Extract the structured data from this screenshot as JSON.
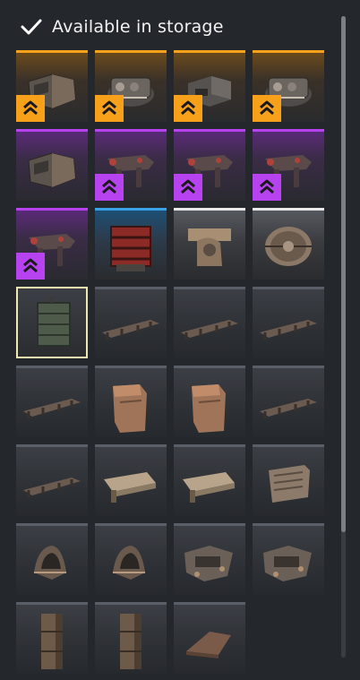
{
  "header": {
    "title": "Available in storage",
    "icon": "check-icon"
  },
  "colors": {
    "orange": "#f7a11a",
    "purple": "#b743f0",
    "blue": "#39a3e6",
    "white": "#e8e8e8",
    "selected_border": "#efe8b0",
    "background": "#24272c"
  },
  "items": [
    {
      "name": "item-cabin-1",
      "rarity": "orange",
      "badge": true,
      "shape": "cabin"
    },
    {
      "name": "item-engine-1",
      "rarity": "orange",
      "badge": true,
      "shape": "engine"
    },
    {
      "name": "item-engine-2",
      "rarity": "orange",
      "badge": true,
      "shape": "block"
    },
    {
      "name": "item-engine-3",
      "rarity": "orange",
      "badge": true,
      "shape": "engine"
    },
    {
      "name": "item-cabin-2",
      "rarity": "purple",
      "badge": false,
      "shape": "cabin"
    },
    {
      "name": "item-weapon-1",
      "rarity": "purple",
      "badge": true,
      "shape": "weapon"
    },
    {
      "name": "item-weapon-2",
      "rarity": "purple",
      "badge": true,
      "shape": "weapon"
    },
    {
      "name": "item-weapon-3",
      "rarity": "purple",
      "badge": true,
      "shape": "weapon"
    },
    {
      "name": "item-weapon-4",
      "rarity": "purple",
      "badge": true,
      "shape": "weapon"
    },
    {
      "name": "item-generator",
      "rarity": "blue",
      "badge": false,
      "shape": "generator"
    },
    {
      "name": "item-turret",
      "rarity": "white",
      "badge": false,
      "shape": "turret"
    },
    {
      "name": "item-drum",
      "rarity": "white",
      "badge": false,
      "shape": "drum"
    },
    {
      "name": "item-box-selected",
      "rarity": "selected",
      "badge": false,
      "shape": "box"
    },
    {
      "name": "item-frame-1",
      "rarity": "common",
      "badge": false,
      "shape": "frame"
    },
    {
      "name": "item-frame-2",
      "rarity": "common",
      "badge": false,
      "shape": "frame"
    },
    {
      "name": "item-frame-3",
      "rarity": "common",
      "badge": false,
      "shape": "frame"
    },
    {
      "name": "item-frame-4",
      "rarity": "common",
      "badge": false,
      "shape": "frame"
    },
    {
      "name": "item-plate-1",
      "rarity": "common",
      "badge": false,
      "shape": "plate"
    },
    {
      "name": "item-plate-2",
      "rarity": "common",
      "badge": false,
      "shape": "plate"
    },
    {
      "name": "item-frame-5",
      "rarity": "common",
      "badge": false,
      "shape": "frame"
    },
    {
      "name": "item-frame-6",
      "rarity": "common",
      "badge": false,
      "shape": "frame"
    },
    {
      "name": "item-panel-1",
      "rarity": "common",
      "badge": false,
      "shape": "panel"
    },
    {
      "name": "item-panel-2",
      "rarity": "common",
      "badge": false,
      "shape": "panel"
    },
    {
      "name": "item-box-2",
      "rarity": "common",
      "badge": false,
      "shape": "crate"
    },
    {
      "name": "item-armor-1",
      "rarity": "common",
      "badge": false,
      "shape": "armor"
    },
    {
      "name": "item-armor-2",
      "rarity": "common",
      "badge": false,
      "shape": "armor"
    },
    {
      "name": "item-chassis-1",
      "rarity": "common",
      "badge": false,
      "shape": "chassis"
    },
    {
      "name": "item-chassis-2",
      "rarity": "common",
      "badge": false,
      "shape": "chassis"
    },
    {
      "name": "item-pillar-1",
      "rarity": "common",
      "badge": false,
      "shape": "pillar"
    },
    {
      "name": "item-pillar-2",
      "rarity": "common",
      "badge": false,
      "shape": "pillar"
    },
    {
      "name": "item-ramp",
      "rarity": "common",
      "badge": false,
      "shape": "ramp"
    }
  ],
  "scroll": {
    "position": 0
  }
}
